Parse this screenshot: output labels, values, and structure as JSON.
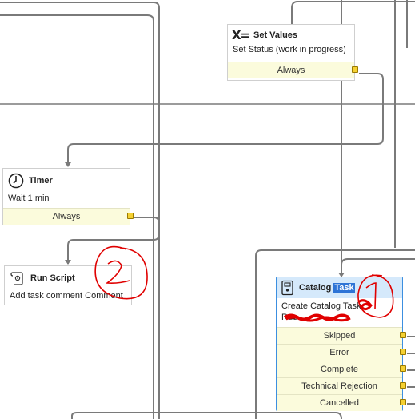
{
  "nodes": {
    "set_values": {
      "icon": "assignment-icon",
      "icon_text": "X=",
      "title": "Set Values",
      "description": "Set Status (work in progress)",
      "conditions": [
        "Always"
      ]
    },
    "timer": {
      "icon": "clock-icon",
      "title": "Timer",
      "description": "Wait 1 min",
      "conditions": [
        "Always"
      ]
    },
    "run_script": {
      "icon": "script-icon",
      "title": "Run Script",
      "description": "Add task comment Comment"
    },
    "catalog_task": {
      "icon": "catalog-task-icon",
      "title_prefix": "Catalog",
      "title_selected": "Task",
      "description_line1": "Create Catalog Task",
      "description_line2": "Rɑ̶̶̶̶̶̶̶̶̶̶e",
      "conditions": [
        "Skipped",
        "Error",
        "Complete",
        "Technical Rejection",
        "Cancelled"
      ]
    }
  },
  "annotations": [
    "1",
    "2"
  ],
  "colors": {
    "connector": "#7a7a7a",
    "condition_bg": "#fbfbdc",
    "port": "#f5d132",
    "selected_border": "#3c8fe0",
    "selected_header": "#d5e9fb",
    "annotation_red": "#e00000"
  }
}
